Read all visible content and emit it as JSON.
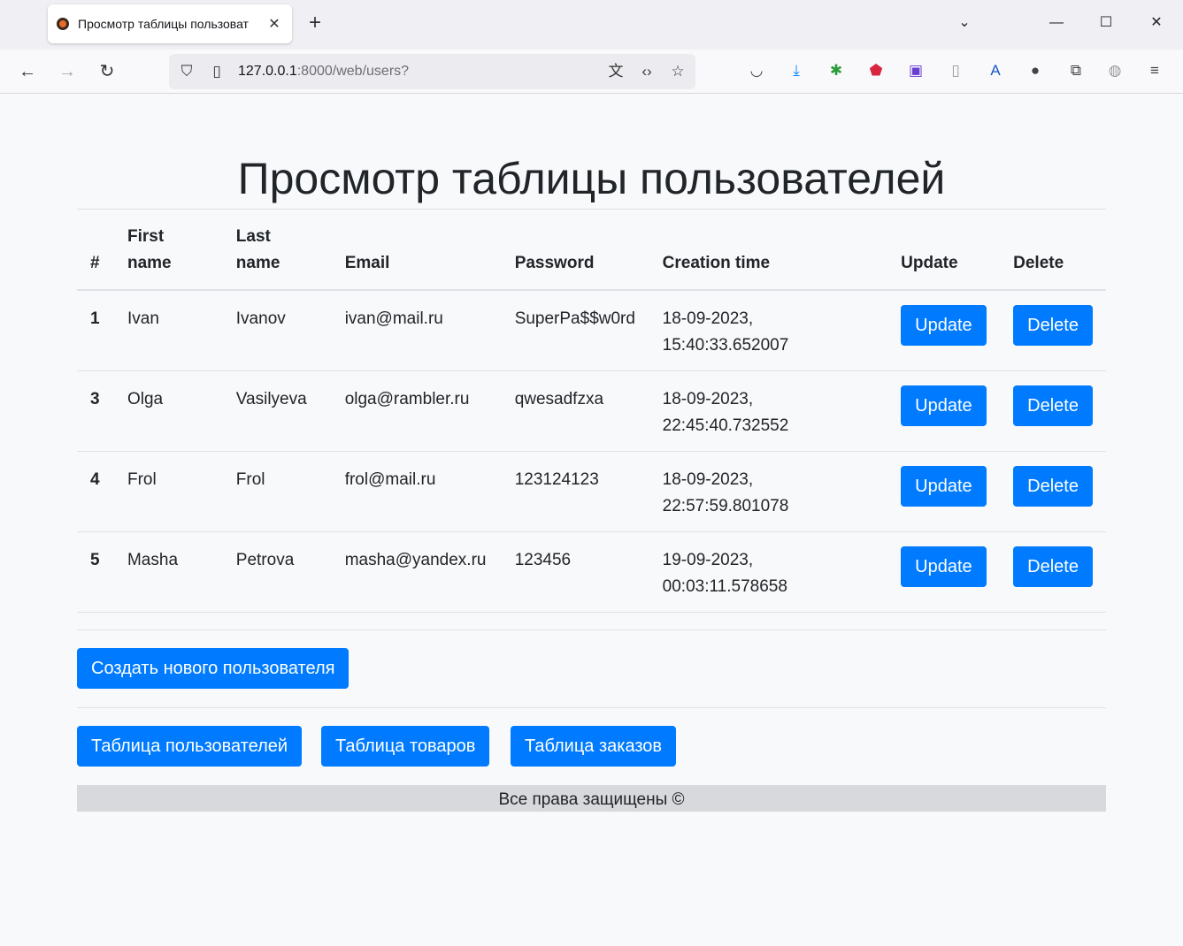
{
  "browser": {
    "tab_title": "Просмотр таблицы пользоват",
    "url_host": "127.0.0.1",
    "url_rest": ":8000/web/users?",
    "icons": [
      "back-arrow-icon",
      "forward-arrow-icon",
      "reload-icon",
      "shield-icon",
      "page-icon",
      "translate-icon",
      "code-icon",
      "star-icon",
      "pocket-icon",
      "download-icon",
      "extension-icon",
      "block-icon",
      "extension-icon",
      "phone-icon",
      "translate-icon",
      "extension-icon",
      "puzzle-icon",
      "globe-icon",
      "menu-icon"
    ]
  },
  "page": {
    "title": "Просмотр таблицы пользователей",
    "columns": [
      "#",
      "First name",
      "Last name",
      "Email",
      "Password",
      "Creation time",
      "Update",
      "Delete"
    ],
    "rows": [
      {
        "id": "1",
        "first": "Ivan",
        "last": "Ivanov",
        "email": "ivan@mail.ru",
        "password": "SuperPa$$w0rd",
        "created_date": "18-09-2023,",
        "created_time": "15:40:33.652007",
        "update": "Update",
        "delete": "Delete"
      },
      {
        "id": "3",
        "first": "Olga",
        "last": "Vasilyeva",
        "email": "olga@rambler.ru",
        "password": "qwesadfzxa",
        "created_date": "18-09-2023,",
        "created_time": "22:45:40.732552",
        "update": "Update",
        "delete": "Delete"
      },
      {
        "id": "4",
        "first": "Frol",
        "last": "Frol",
        "email": "frol@mail.ru",
        "password": "123124123",
        "created_date": "18-09-2023,",
        "created_time": "22:57:59.801078",
        "update": "Update",
        "delete": "Delete"
      },
      {
        "id": "5",
        "first": "Masha",
        "last": "Petrova",
        "email": "masha@yandex.ru",
        "password": "123456",
        "created_date": "19-09-2023,",
        "created_time": "00:03:11.578658",
        "update": "Update",
        "delete": "Delete"
      }
    ],
    "create_button": "Создать нового пользователя",
    "nav_buttons": [
      "Таблица пользователей",
      "Таблица товаров",
      "Таблица заказов"
    ],
    "footer": "Все права защищены ©",
    "accent_color": "#007bff"
  }
}
